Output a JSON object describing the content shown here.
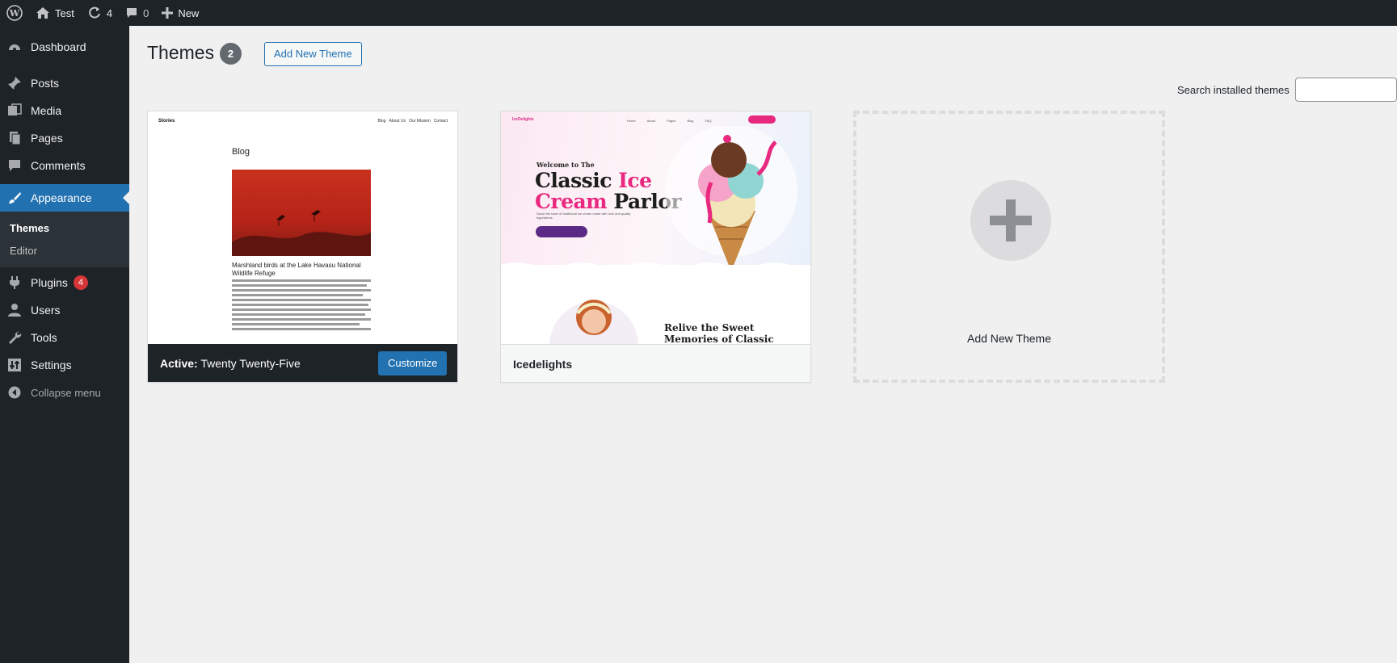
{
  "adminbar": {
    "site_name": "Test",
    "updates_count": "4",
    "comments_count": "0",
    "new_label": "New"
  },
  "sidebar": {
    "items": [
      {
        "label": "Dashboard",
        "icon": "dashboard-icon"
      },
      {
        "label": "Posts",
        "icon": "pin-icon"
      },
      {
        "label": "Media",
        "icon": "media-icon"
      },
      {
        "label": "Pages",
        "icon": "pages-icon"
      },
      {
        "label": "Comments",
        "icon": "comment-icon"
      },
      {
        "label": "Appearance",
        "icon": "brush-icon",
        "active": true
      },
      {
        "label": "Plugins",
        "icon": "plug-icon",
        "badge": "4"
      },
      {
        "label": "Users",
        "icon": "user-icon"
      },
      {
        "label": "Tools",
        "icon": "wrench-icon"
      },
      {
        "label": "Settings",
        "icon": "sliders-icon"
      }
    ],
    "submenu": [
      "Themes",
      "Editor"
    ],
    "collapse_label": "Collapse menu"
  },
  "main": {
    "title": "Themes",
    "title_count": "2",
    "add_new_button": "Add New Theme",
    "search_label": "Search installed themes",
    "search_value": ""
  },
  "themes": [
    {
      "active_prefix": "Active:",
      "name": "Twenty Twenty-Five",
      "customize_label": "Customize",
      "preview": {
        "logo": "Stories",
        "nav": [
          "Blog",
          "About Us",
          "Our Mission",
          "Contact"
        ],
        "heading": "Blog",
        "caption": "Marshland birds at the Lake Havasu National Wildlife Refuge"
      }
    },
    {
      "name": "Icedelights",
      "preview": {
        "brand": "IceDelights",
        "nav": [
          "Home",
          "About",
          "Pages",
          "Blog",
          "FAQ"
        ],
        "welcome": "Welcome to The",
        "headline_1": "Classic",
        "headline_2": "Ice",
        "headline_3": "Cream",
        "headline_4": "Parlor",
        "subtext": "Savor the taste of traditional ice cream made with love and quality ingredients",
        "section_title": "Relive the Sweet Memories of Classic Ice Creams"
      }
    }
  ],
  "add_new_card_label": "Add New Theme",
  "colors": {
    "admin_dark": "#1d2327",
    "accent_blue": "#2271b1",
    "badge_red": "#d63638",
    "ice_pink": "#e9287f"
  }
}
